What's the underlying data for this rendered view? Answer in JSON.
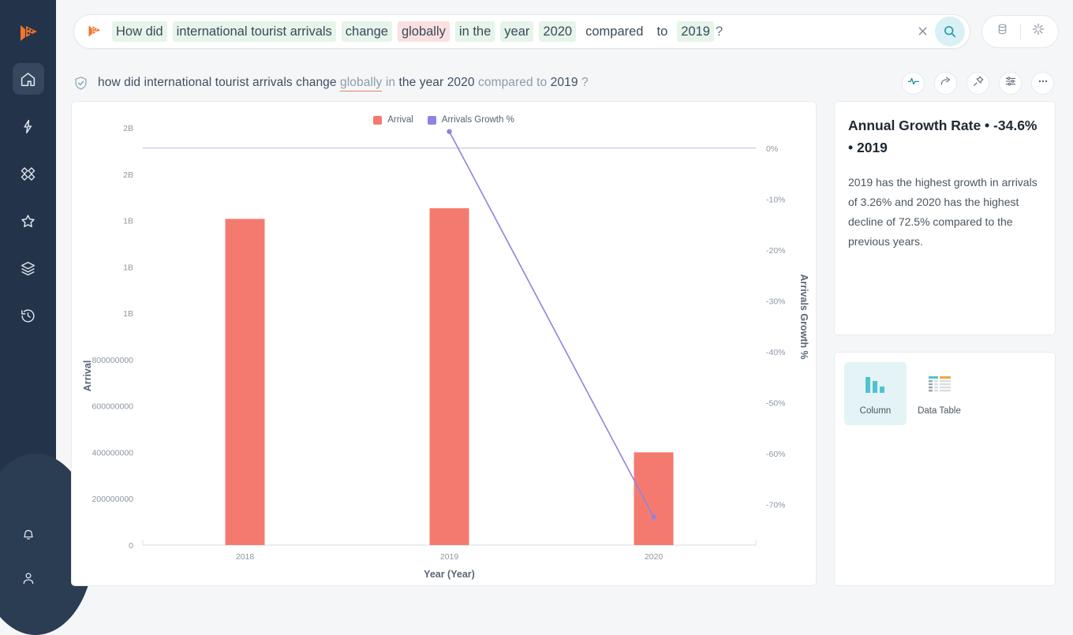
{
  "sidebar": {
    "logo": "thoughtspot-logo",
    "items": [
      {
        "name": "home",
        "icon": "home-icon",
        "active": true
      },
      {
        "name": "spark",
        "icon": "spark-icon",
        "active": false
      },
      {
        "name": "apps",
        "icon": "apps-grid-icon",
        "active": false
      },
      {
        "name": "favorites",
        "icon": "star-icon",
        "active": false
      },
      {
        "name": "data",
        "icon": "layers-icon",
        "active": false
      },
      {
        "name": "history",
        "icon": "history-clock-icon",
        "active": false
      }
    ],
    "bottom": [
      {
        "name": "notifications",
        "icon": "bell-icon"
      },
      {
        "name": "profile",
        "icon": "user-icon"
      }
    ]
  },
  "search": {
    "tokens": [
      {
        "text": "How did",
        "style": "green"
      },
      {
        "text": "international tourist arrivals",
        "style": "green"
      },
      {
        "text": "change",
        "style": "green"
      },
      {
        "text": "globally",
        "style": "pink"
      },
      {
        "text": "in the",
        "style": "green"
      },
      {
        "text": "year",
        "style": "green"
      },
      {
        "text": "2020",
        "style": "green"
      },
      {
        "text": "compared",
        "style": "plain"
      },
      {
        "text": "to",
        "style": "plain"
      },
      {
        "text": "2019",
        "style": "green"
      },
      {
        "text": "?",
        "style": "qmark"
      }
    ],
    "clear_label": "clear-icon",
    "go_label": "search-icon",
    "pill": {
      "data_source_icon": "database-icon",
      "sparkle_icon": "sparkle-icon"
    }
  },
  "question": {
    "check_icon": "verified-shield-icon",
    "parts": [
      {
        "text": "how did international tourist arrivals change ",
        "style": "normal"
      },
      {
        "text": "globally",
        "style": "underline"
      },
      {
        "text": " in",
        "style": "muted"
      },
      {
        "text": " the year 2020 ",
        "style": "normal"
      },
      {
        "text": "compared to",
        "style": "muted"
      },
      {
        "text": " 2019 ",
        "style": "normal"
      },
      {
        "text": "?",
        "style": "muted"
      }
    ],
    "actions": [
      {
        "name": "monitor",
        "icon": "pulse-icon"
      },
      {
        "name": "share",
        "icon": "share-arrow-icon"
      },
      {
        "name": "pin",
        "icon": "pin-icon"
      },
      {
        "name": "configure",
        "icon": "sliders-icon"
      },
      {
        "name": "more",
        "icon": "ellipsis-icon"
      }
    ]
  },
  "insight": {
    "title": "Annual Growth Rate • -34.6% • 2019",
    "body": "2019 has the highest growth in arrivals of 3.26% and 2020 has the highest decline of 72.5% compared to the previous years."
  },
  "viz_options": [
    {
      "label": "Column",
      "icon": "column-chart-icon",
      "selected": true
    },
    {
      "label": "Data Table",
      "icon": "data-table-icon",
      "selected": false
    }
  ],
  "colors": {
    "bar": "#F47A70",
    "line": "#8C84DE",
    "accent_teal": "#2EA3B0",
    "rail_bg": "#23344A",
    "page_bg": "#F4F6F8"
  },
  "chart_data": {
    "type": "bar",
    "title": "",
    "xlabel": "Year (Year)",
    "ylabel": "Arrival",
    "y2label": "Arrivals Growth %",
    "categories": [
      "2018",
      "2019",
      "2020"
    ],
    "grid": false,
    "legend_position": "top-center",
    "series": [
      {
        "name": "Arrival",
        "type": "bar",
        "axis": "left",
        "color": "#F47A70",
        "values": [
          1407000000,
          1453000000,
          400000000
        ]
      },
      {
        "name": "Arrivals Growth %",
        "type": "line",
        "axis": "right",
        "color": "#8C84DE",
        "values": [
          null,
          3.26,
          -72.5
        ]
      }
    ],
    "yticks_left": [
      "2B",
      "2B",
      "1B",
      "1B",
      "1B",
      "800000000",
      "600000000",
      "400000000",
      "200000000",
      "0"
    ],
    "ytick_left_values": [
      1800000000,
      1600000000,
      1400000000,
      1200000000,
      1000000000,
      800000000,
      600000000,
      400000000,
      200000000,
      0
    ],
    "ylim_left": [
      0,
      1800000000
    ],
    "yticks_right": [
      "0%",
      "-10%",
      "-20%",
      "-30%",
      "-40%",
      "-50%",
      "-60%",
      "-70%"
    ],
    "ytick_right_values": [
      0,
      -10,
      -20,
      -30,
      -40,
      -50,
      -60,
      -70
    ],
    "ylim_right": [
      -78,
      4
    ]
  }
}
